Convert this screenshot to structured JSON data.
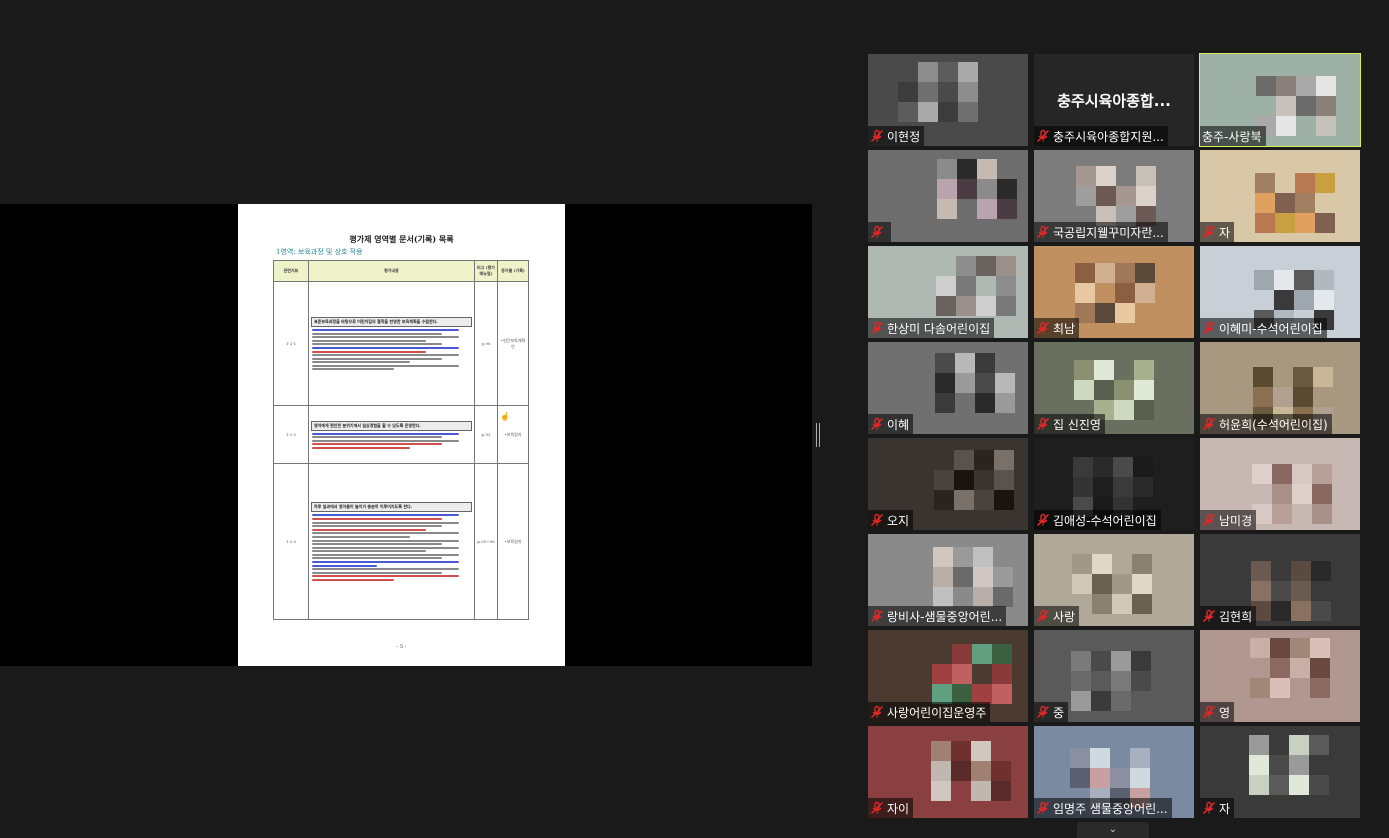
{
  "document": {
    "title": "평가제 영역별 문서(기록) 목록",
    "subtitle": "1영역: 보육과정 및 상호 작용",
    "headers": [
      "관련지표",
      "평가내용",
      "비고\n(평가\n매뉴얼)",
      "증거물\n(기록)"
    ],
    "rows": [
      {
        "code": "1-2-1",
        "ref": "p.90",
        "doc": "•연간보육계획안",
        "box": "표준보육과정을 바탕으로 어린이집의 철학을 반영한 보육계획을 수립한다."
      },
      {
        "code": "1-2-2",
        "ref": "p.93",
        "doc": "•보육일지",
        "box": "영아에게 편안한 분위기에서 일상경험을 할 수 있도록 운영한다."
      },
      {
        "code": "1-2-3",
        "ref": "p.95~96",
        "doc": "•보육일지",
        "box": "하루 일과에서 영아들이 놀이가 충분히 이루어지도록 한다."
      }
    ],
    "page_number": "- 5 -"
  },
  "participants": [
    {
      "name": "이현정",
      "active": false,
      "muted": true
    },
    {
      "name": "충주시육아종합지원...",
      "display_name": "충주시육아종합...",
      "active": false,
      "muted": true
    },
    {
      "name": "충주-사랑북",
      "active": true,
      "muted": false
    },
    {
      "name": "",
      "active": false,
      "muted": true
    },
    {
      "name": "국공립지웰꾸미자란...",
      "active": false,
      "muted": true
    },
    {
      "name": "자",
      "active": false,
      "muted": true
    },
    {
      "name": "한상미 다솜어린이집",
      "active": false,
      "muted": true
    },
    {
      "name": "최남",
      "active": false,
      "muted": true
    },
    {
      "name": "이혜미-수석어린이집",
      "active": false,
      "muted": true
    },
    {
      "name": "이혜",
      "active": false,
      "muted": true
    },
    {
      "name": "집 신진영",
      "active": false,
      "muted": true
    },
    {
      "name": "허윤희(수석어린이집)",
      "active": false,
      "muted": true
    },
    {
      "name": "오지",
      "active": false,
      "muted": true
    },
    {
      "name": "김애성-수석어린이집",
      "active": false,
      "muted": true
    },
    {
      "name": "남미경",
      "active": false,
      "muted": true
    },
    {
      "name": "랑비사-샘물중앙어린...",
      "active": false,
      "muted": true
    },
    {
      "name": "사랑",
      "active": false,
      "muted": true
    },
    {
      "name": "김현희",
      "active": false,
      "muted": true
    },
    {
      "name": "사랑어린이집운영주",
      "active": false,
      "muted": true
    },
    {
      "name": "중",
      "active": false,
      "muted": true
    },
    {
      "name": "영",
      "active": false,
      "muted": true
    },
    {
      "name": "자이",
      "active": false,
      "muted": true
    },
    {
      "name": "임명주 샘물중앙어린...",
      "active": false,
      "muted": true
    },
    {
      "name": "자",
      "active": false,
      "muted": true
    }
  ],
  "colors": {
    "active_speaker_border": "#d4ef5a",
    "muted_mic": "#e02828",
    "doc_header_bg": "#eef3c9"
  },
  "icons": {
    "mic": "mic-muted-icon",
    "more": "chevron-down-icon"
  }
}
